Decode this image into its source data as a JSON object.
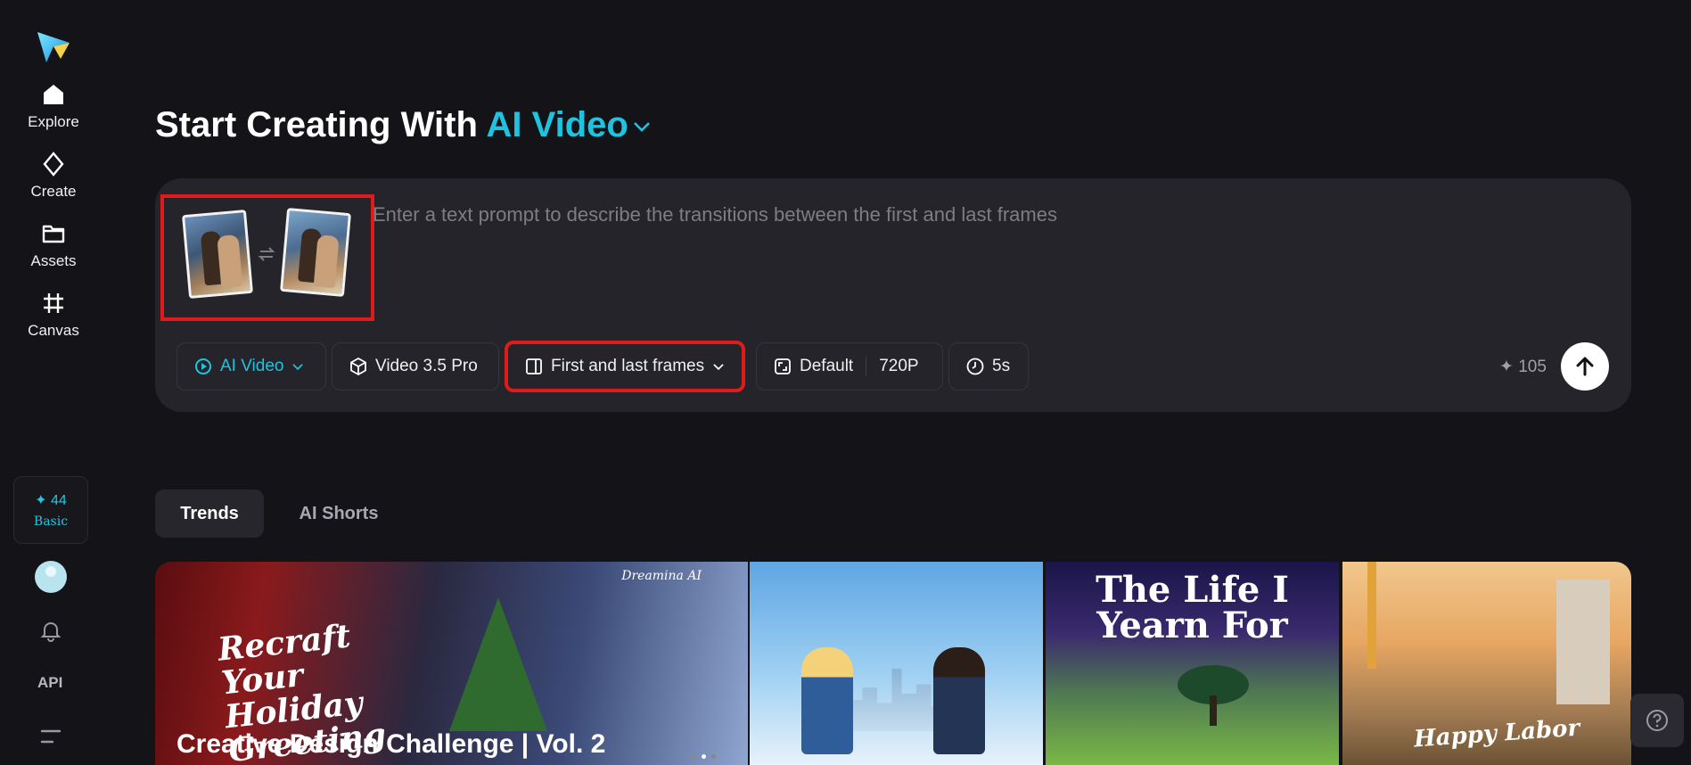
{
  "sidebar": {
    "logo": "dreamina-logo",
    "items": [
      {
        "label": "Explore",
        "icon": "home-icon"
      },
      {
        "label": "Create",
        "icon": "sparkle-icon"
      },
      {
        "label": "Assets",
        "icon": "folder-icon"
      },
      {
        "label": "Canvas",
        "icon": "canvas-icon"
      }
    ],
    "credits": {
      "count": "✦ 44",
      "tier": "Basic"
    },
    "api_label": "API"
  },
  "header": {
    "title_prefix": "Start Creating With",
    "title_accent": "AI Video"
  },
  "prompt": {
    "placeholder": "Enter a text prompt to describe the transitions between the first and last frames",
    "value": ""
  },
  "toolbar": {
    "ai_video_label": "AI Video",
    "model_label": "Video 3.5 Pro",
    "mode_label": "First and last frames",
    "ratio_label": "Default",
    "resolution_label": "720P",
    "duration_label": "5s",
    "cost": "✦ 105"
  },
  "tabs": [
    {
      "label": "Trends",
      "active": true
    },
    {
      "label": "AI Shorts",
      "active": false
    }
  ],
  "cards": {
    "c1": {
      "script": "Recraft Your Holiday Greeting",
      "brand": "Dreamina AI",
      "title": "Creative Design Challenge | Vol. 2"
    },
    "c3": {
      "text": "The Life I Yearn For"
    },
    "c4": {
      "text": "Happy Labor"
    }
  },
  "colors": {
    "accent": "#1fc3e0",
    "highlight": "#e01b1b",
    "background": "#141418",
    "panel": "#24242a"
  }
}
